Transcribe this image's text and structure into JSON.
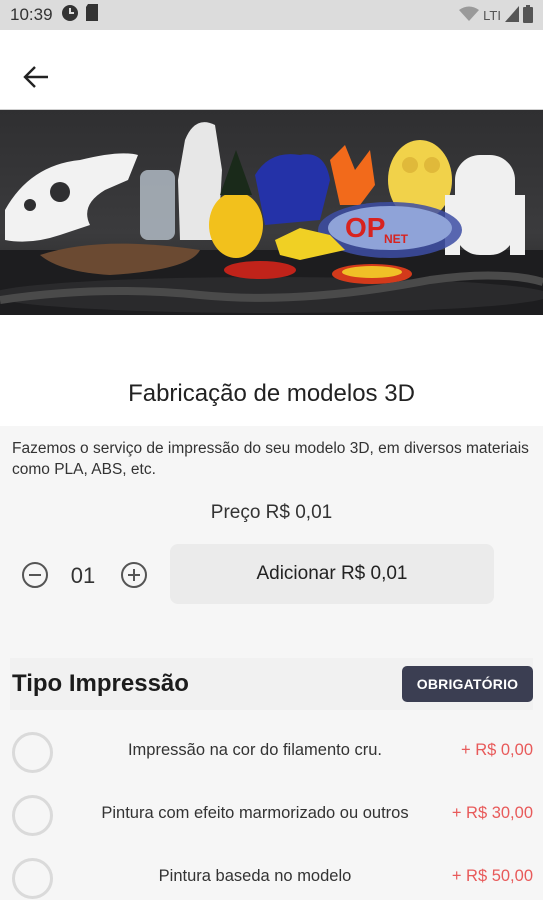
{
  "status_bar": {
    "time": "10:39",
    "network": "LTI"
  },
  "product": {
    "title": "Fabricação de modelos 3D",
    "description": "Fazemos o serviço de impressão do seu modelo 3D, em diversos materiais como PLA, ABS, etc.",
    "price_label": "Preço R$ 0,01",
    "logo_text": "OP",
    "logo_subtext": "NET"
  },
  "quantity": {
    "value": "01"
  },
  "add_button": {
    "label": "Adicionar R$ 0,01"
  },
  "section": {
    "title": "Tipo Impressão",
    "badge": "OBRIGATÓRIO",
    "options": [
      {
        "label": "Impressão na cor do filamento cru.",
        "price": "+ R$ 0,00"
      },
      {
        "label": "Pintura com efeito marmorizado ou outros",
        "price": "+ R$ 30,00"
      },
      {
        "label": "Pintura baseda no modelo",
        "price": "+ R$ 50,00"
      }
    ]
  },
  "colors": {
    "accent_price": "#e85a5a",
    "badge_bg": "#3b3e52",
    "status_bar_bg": "#dcdcdc"
  }
}
